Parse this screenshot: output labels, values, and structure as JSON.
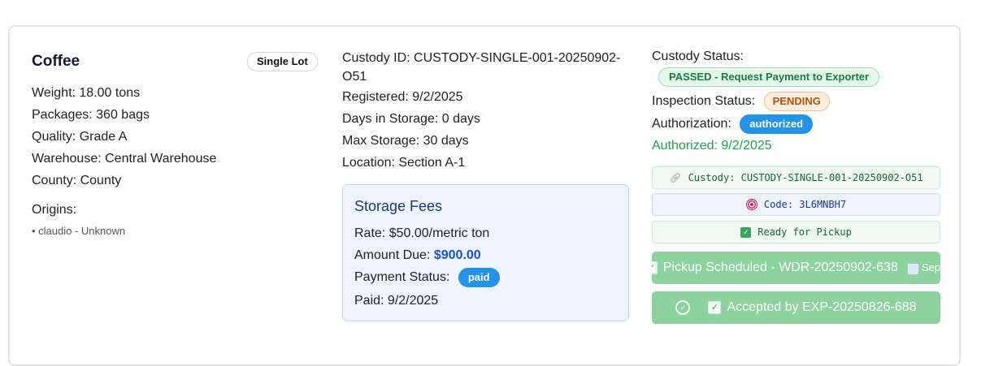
{
  "commodity": {
    "title": "Coffee",
    "lot_type": "Single Lot",
    "weight": "Weight: 18.00 tons",
    "packages": "Packages: 360 bags",
    "quality": "Quality: Grade A",
    "warehouse": "Warehouse: Central Warehouse",
    "county": "County: County",
    "origins_label": "Origins:",
    "origins": [
      "• claudio - Unknown"
    ]
  },
  "custody": {
    "id_line_1": "Custody ID: CUSTODY-SINGLE-001-20250902-",
    "id_line_2": "O51",
    "registered": "Registered: 9/2/2025",
    "days_in_storage": "Days in Storage: 0 days",
    "max_storage": "Max Storage: 30 days",
    "location": "Location: Section A-1"
  },
  "fees": {
    "title": "Storage Fees",
    "rate": "Rate: $50.00/metric ton",
    "amount_label": "Amount Due:",
    "amount_value": "$900.00",
    "payment_label": "Payment Status:",
    "payment_status": "paid",
    "paid_date": "Paid: 9/2/2025"
  },
  "status": {
    "custody_label": "Custody Status:",
    "custody_value": "PASSED - Request Payment to Exporter",
    "inspection_label": "Inspection Status:",
    "inspection_value": "PENDING",
    "authorization_label": "Authorization:",
    "authorization_value": "authorized",
    "authorized_date": "Authorized: 9/2/2025"
  },
  "info_boxes": {
    "custody": "Custody: CUSTODY-SINGLE-001-20250902-O51",
    "code": "Code: 3L6MNBH7",
    "ready": "Ready for Pickup"
  },
  "actions": {
    "pickup": "Pickup Scheduled - WDR-20250902-638",
    "pickup_date": "Sep",
    "accepted": "Accepted by EXP-20250826-688"
  },
  "icons": {
    "link": "link-icon",
    "target": "target-icon",
    "check": "check-box-icon",
    "circle_check": "circle-check-icon",
    "calendar": "calendar-icon"
  },
  "colors": {
    "passed_green": "#15803d",
    "pending_orange": "#b45309",
    "badge_blue": "#2293e8",
    "action_green": "#8cd3a0",
    "amount_blue": "#1d4ed8"
  }
}
